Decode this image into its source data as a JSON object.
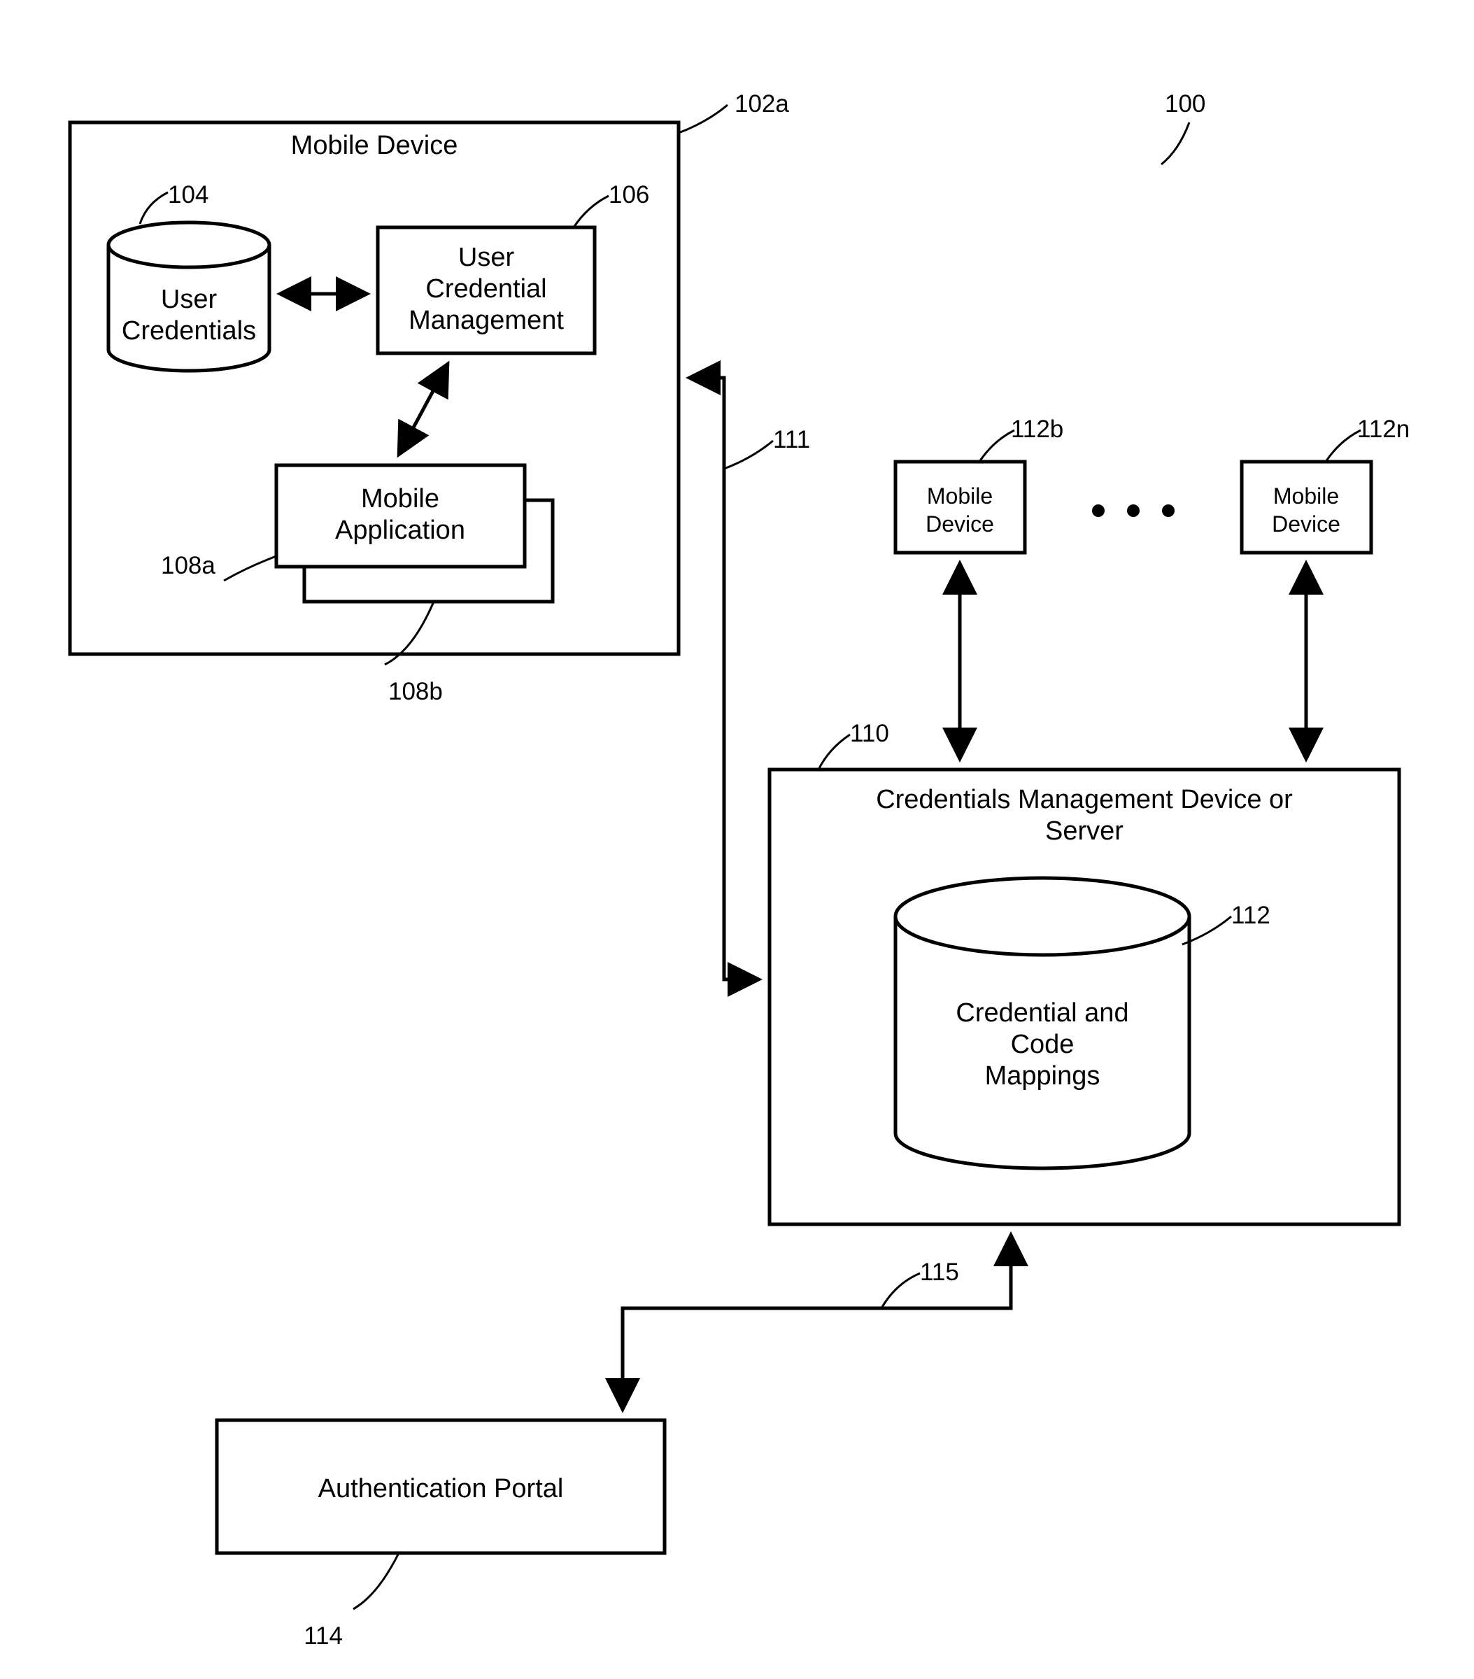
{
  "figure_ref": "100",
  "mobile_device_a": {
    "title": "Mobile Device",
    "ref": "102a",
    "user_credentials": {
      "label": "User\nCredentials",
      "ref": "104"
    },
    "user_cred_mgmt": {
      "label": "User\nCredential\nManagement",
      "ref": "106"
    },
    "mobile_app": {
      "label": "Mobile\nApplication",
      "ref_a": "108a",
      "ref_b": "108b"
    }
  },
  "link_111": "111",
  "mobile_device_b": {
    "top": "Mobile",
    "bottom": "Device",
    "ref": "112b"
  },
  "mobile_device_n": {
    "top": "Mobile",
    "bottom": "Device",
    "ref": "112n"
  },
  "ellipsis": "● ● ●",
  "server": {
    "title_top": "Credentials Management Device or",
    "title_bottom": "Server",
    "ref": "110",
    "db": {
      "l1": "Credential and",
      "l2": "Code",
      "l3": "Mappings",
      "ref": "112"
    }
  },
  "link_115": "115",
  "auth_portal": {
    "label": "Authentication Portal",
    "ref": "114"
  }
}
